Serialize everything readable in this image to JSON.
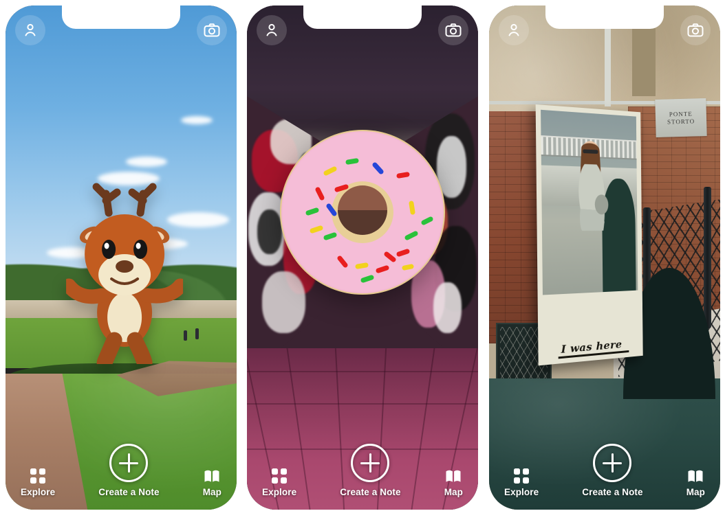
{
  "app": {
    "screens": [
      {
        "id": "screen-park",
        "scene_name": "park-ar-deer",
        "theme_color": "#5a9fd4",
        "top_left_icon": "profile-icon",
        "top_right_icon": "camera-icon",
        "ar_object": "deer-character",
        "nav": {
          "explore_label": "Explore",
          "explore_icon": "grid-icon",
          "create_label": "Create a Note",
          "create_icon": "plus-circle-icon",
          "map_label": "Map",
          "map_icon": "map-book-icon"
        }
      },
      {
        "id": "screen-tunnel",
        "scene_name": "graffiti-tunnel-ar-donut",
        "theme_color": "#3a2331",
        "top_left_icon": "profile-icon",
        "top_right_icon": "camera-icon",
        "ar_object": "donut-character",
        "nav": {
          "explore_label": "Explore",
          "explore_icon": "grid-icon",
          "create_label": "Create a Note",
          "create_icon": "plus-circle-icon",
          "map_label": "Map",
          "map_icon": "map-book-icon"
        }
      },
      {
        "id": "screen-venice",
        "scene_name": "venice-canal-ar-polaroid",
        "theme_color": "#2f4f4a",
        "top_left_icon": "profile-icon",
        "top_right_icon": "camera-icon",
        "ar_object": "polaroid-note",
        "polaroid_caption": "I was here",
        "street_sign": {
          "line1": "PONTE",
          "line2": "STORTO"
        },
        "nav": {
          "explore_label": "Explore",
          "explore_icon": "grid-icon",
          "create_label": "Create a Note",
          "create_icon": "plus-circle-icon",
          "map_label": "Map",
          "map_icon": "map-book-icon"
        }
      }
    ]
  }
}
